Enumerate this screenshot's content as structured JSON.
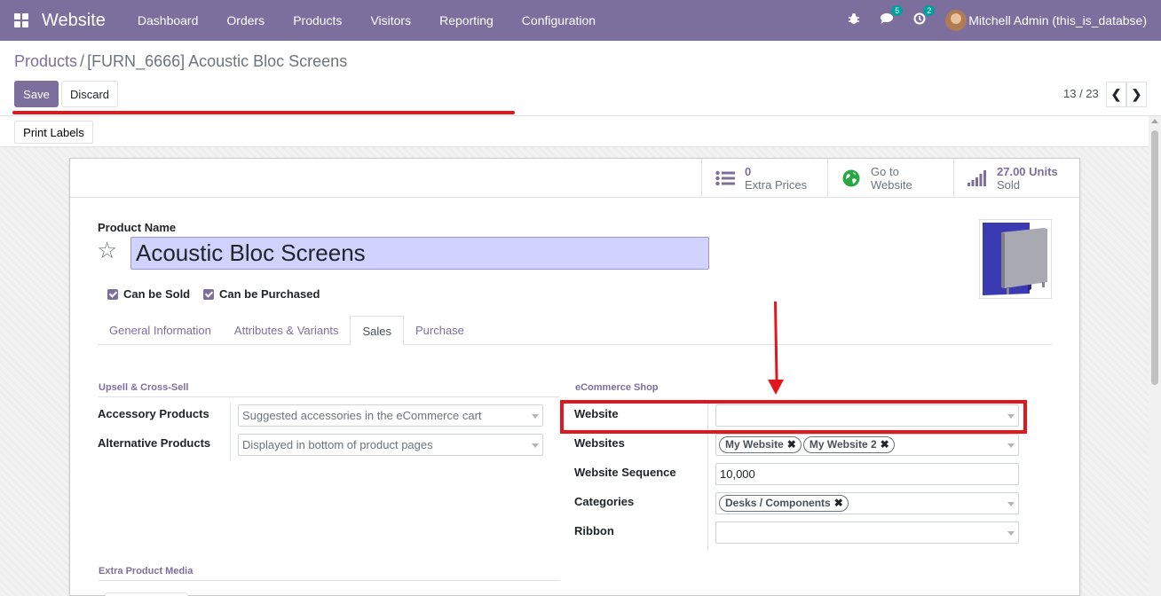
{
  "navbar": {
    "app_title": "Website",
    "menu": [
      "Dashboard",
      "Orders",
      "Products",
      "Visitors",
      "Reporting",
      "Configuration"
    ],
    "messages_count": "5",
    "activities_count": "2",
    "user_name": "Mitchell Admin (this_is_databse)",
    "color": "#7c6f9e"
  },
  "breadcrumb": {
    "parent": "Products",
    "separator": "/",
    "current": "[FURN_6666] Acoustic Bloc Screens"
  },
  "actions": {
    "save": "Save",
    "discard": "Discard",
    "print_labels": "Print Labels"
  },
  "pager": {
    "value": "13 / 23"
  },
  "smart_buttons": [
    {
      "value": "0",
      "label": "Extra Prices",
      "icon": "list-icon"
    },
    {
      "value": "Go to",
      "label": "Website",
      "icon": "globe-icon"
    },
    {
      "value": "27.00 Units",
      "label": "Sold",
      "icon": "signal-icon"
    }
  ],
  "product": {
    "name_label": "Product Name",
    "name": "Acoustic Bloc Screens",
    "can_be_sold_label": "Can be Sold",
    "can_be_purchased_label": "Can be Purchased",
    "can_be_sold": true,
    "can_be_purchased": true
  },
  "tabs": [
    "General Information",
    "Attributes & Variants",
    "Sales",
    "Purchase"
  ],
  "active_tab": "Sales",
  "upsell": {
    "title": "Upsell & Cross-Sell",
    "accessory_label": "Accessory Products",
    "accessory_placeholder": "Suggested accessories in the eCommerce cart",
    "alternative_label": "Alternative Products",
    "alternative_placeholder": "Displayed in bottom of product pages"
  },
  "ecommerce": {
    "title": "eCommerce Shop",
    "website_label": "Website",
    "website_value": "",
    "websites_label": "Websites",
    "websites": [
      "My Website",
      "My Website 2"
    ],
    "sequence_label": "Website Sequence",
    "sequence_value": "10,000",
    "categories_label": "Categories",
    "categories": [
      "Desks / Components"
    ],
    "ribbon_label": "Ribbon",
    "ribbon_value": ""
  },
  "media": {
    "title": "Extra Product Media"
  },
  "annotation_color": "#e0171d"
}
